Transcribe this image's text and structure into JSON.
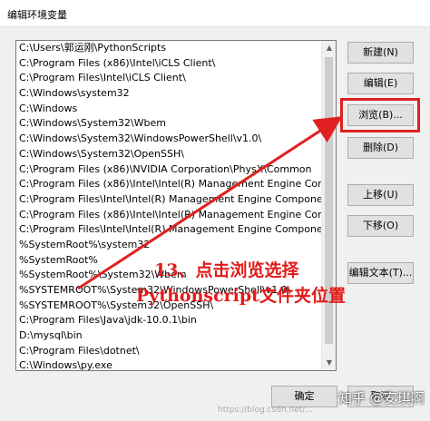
{
  "window": {
    "title": "编辑环境变量"
  },
  "paths": [
    "C:\\Users\\郭运刚\\PythonScripts",
    "C:\\Program Files (x86)\\Intel\\iCLS Client\\",
    "C:\\Program Files\\Intel\\iCLS Client\\",
    "C:\\Windows\\system32",
    "C:\\Windows",
    "C:\\Windows\\System32\\Wbem",
    "C:\\Windows\\System32\\WindowsPowerShell\\v1.0\\",
    "C:\\Windows\\System32\\OpenSSH\\",
    "C:\\Program Files (x86)\\NVIDIA Corporation\\PhysX\\Common",
    "C:\\Program Files (x86)\\Intel\\Intel(R) Management Engine Componen...",
    "C:\\Program Files\\Intel\\Intel(R) Management Engine Components\\DAL",
    "C:\\Program Files (x86)\\Intel\\Intel(R) Management Engine Componen...",
    "C:\\Program Files\\Intel\\Intel(R) Management Engine Components\\IPT",
    "%SystemRoot%\\system32",
    "%SystemRoot%",
    "%SystemRoot%\\System32\\Wbem",
    "%SYSTEMROOT%\\System32\\WindowsPowerShell\\v1.0\\",
    "%SYSTEMROOT%\\System32\\OpenSSH\\",
    "C:\\Program Files\\Java\\jdk-10.0.1\\bin",
    "D:\\mysql\\bin",
    "C:\\Program Files\\dotnet\\",
    "C:\\Windows\\py.exe"
  ],
  "buttons": {
    "new": "新建(N)",
    "edit": "编辑(E)",
    "browse": "浏览(B)...",
    "delete": "删除(D)",
    "move_up": "上移(U)",
    "move_down": "下移(O)",
    "edit_text": "编辑文本(T)...",
    "ok": "确定",
    "cancel": "取消"
  },
  "annotation": {
    "line1": "13、点击浏览选择",
    "line2": "Pythonscript文件夹位置"
  },
  "watermark": {
    "text": "知乎 @安琪啊",
    "url": "https://blog.csdn.net/..."
  },
  "colors": {
    "annotation_red": "#e31a1a",
    "highlight_border": "#e02020"
  }
}
